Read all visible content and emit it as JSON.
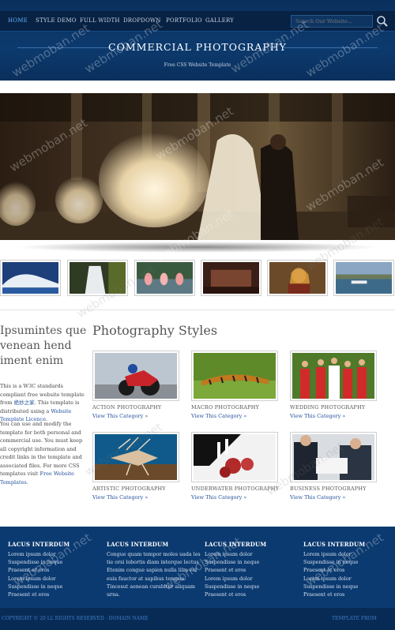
{
  "nav": {
    "items": [
      "HOME",
      "STYLE DEMO",
      "FULL WIDTH",
      "DROPDOWN",
      "PORTFOLIO",
      "GALLERY"
    ],
    "active": "HOME"
  },
  "search": {
    "placeholder": "Search Our Website..."
  },
  "header": {
    "title": "COMMERCIAL PHOTOGRAPHY",
    "subtitle": "Free CSS Website Template"
  },
  "sidebar": {
    "heading": "Ipsumintes que venean hend iment enim",
    "para1_pre": "This is a W3C standards compliant free website template from ",
    "para1_link1": "绝妙之家",
    "para1_mid": ". This template is distributed using a ",
    "para1_link2": "Website Template Licence",
    "para1_post": ".",
    "para2_pre": "You can use and modify the template for both personal and commercial use. You must keep all copyright information and credit links in the template and associated files. For more CSS templates visit ",
    "para2_link": "Free Website Templates",
    "para2_post": "."
  },
  "styles": {
    "heading": "Photography Styles",
    "link_label": "View This Category »",
    "cards": [
      {
        "title": "ACTION PHOTOGRAPHY",
        "image": "motorcycle-racer"
      },
      {
        "title": "MACRO PHOTOGRAPHY",
        "image": "caterpillar"
      },
      {
        "title": "WEDDING PHOTOGRAPHY",
        "image": "bridesmaids"
      },
      {
        "title": "ARTISTIC PHOTOGRAPHY",
        "image": "lionfish"
      },
      {
        "title": "UNDERWATER PHOTOGRAPHY",
        "image": "roses-on-piano"
      },
      {
        "title": "BUSINESS PHOTOGRAPHY",
        "image": "business-meeting"
      }
    ]
  },
  "thumbs": [
    "modern-architecture",
    "waterfall",
    "flamingos",
    "interior",
    "portrait-woman",
    "harbor"
  ],
  "footer": {
    "columns": [
      {
        "heading": "LACUS INTERDUM",
        "items": [
          "Lorem ipsum dolor",
          "Suspendisse in neque",
          "Praesent et eros",
          "Lorem ipsum dolor",
          "Suspendisse in neque",
          "Praesent et eros"
        ]
      },
      {
        "heading": "LACUS INTERDUM",
        "items": [
          "Congue quam tempor moles uada les",
          "tie orsi lobortis diam interque lectus",
          "Etenim congue sapien nulla lilm vel",
          "euis fauctor at sapibus tempus.",
          "Tincesut aenean curabitur aliquam",
          "urna."
        ]
      },
      {
        "heading": "LACUS INTERDUM",
        "items": [
          "Lorem ipsum dolor",
          "Suspendisse in neque",
          "Praesent et eros",
          "Lorem ipsum dolor",
          "Suspendisse in neque",
          "Praesent et eros"
        ]
      },
      {
        "heading": "LACUS INTERDUM",
        "items": [
          "Lorem ipsum dolor",
          "Suspendisse in neque",
          "Praesent et eros",
          "Lorem ipsum dolor",
          "Suspendisse in neque",
          "Praesent et eros"
        ]
      }
    ],
    "copyright": "COPYRIGHT © 20 LL RIGHTS RESERVED - DOMAIN NAME",
    "credit": "TEMPLATE FROM"
  },
  "watermark": "webmoban.net",
  "colors": {
    "header": "#0c3a6e",
    "nav": "#082244",
    "accent": "#1f4f9a",
    "footer": "#0b3a70"
  }
}
